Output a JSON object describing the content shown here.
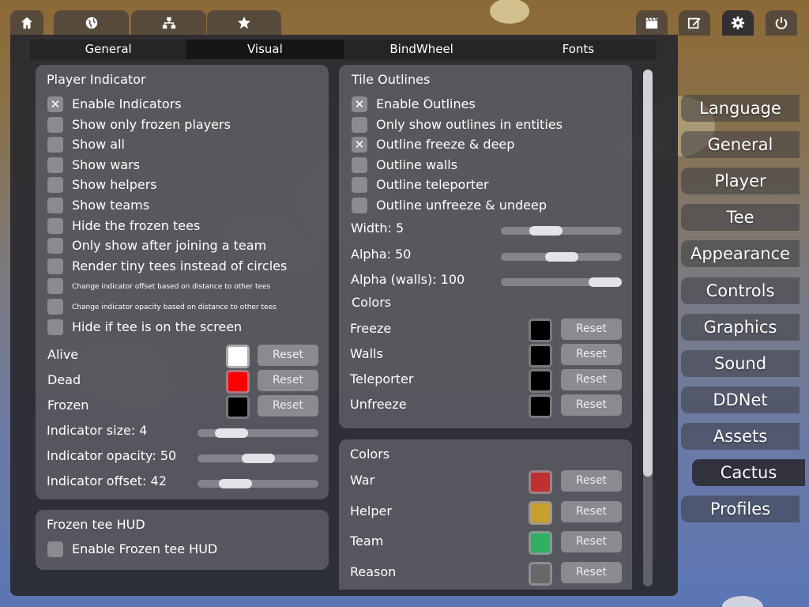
{
  "top_icons": {
    "home": "home-icon",
    "globe": "globe-icon",
    "network": "network-icon",
    "star": "star-icon",
    "demo": "clapperboard-icon",
    "editor": "edit-icon",
    "settings": "gear-icon",
    "quit": "power-icon"
  },
  "subtabs": [
    "General",
    "Visual",
    "BindWheel",
    "Fonts"
  ],
  "active_subtab": "Visual",
  "player_indicator": {
    "title": "Player Indicator",
    "options": [
      {
        "label": "Enable Indicators",
        "checked": true
      },
      {
        "label": "Show only frozen players",
        "checked": false
      },
      {
        "label": "Show all",
        "checked": false
      },
      {
        "label": "Show wars",
        "checked": false
      },
      {
        "label": "Show helpers",
        "checked": false
      },
      {
        "label": "Show teams",
        "checked": false
      },
      {
        "label": "Hide the frozen tees",
        "checked": false
      },
      {
        "label": "Only show after joining a team",
        "checked": false
      },
      {
        "label": "Render tiny tees instead of circles",
        "checked": false
      },
      {
        "label": "Change indicator offset based on distance to other tees",
        "checked": false
      },
      {
        "label": "Change indicator opacity based on distance to other tees",
        "checked": false
      },
      {
        "label": "Hide if tee is on the screen",
        "checked": false
      }
    ],
    "colors": [
      {
        "label": "Alive",
        "color": "#ffffff",
        "reset": "Reset"
      },
      {
        "label": "Dead",
        "color": "#ff0000",
        "reset": "Reset"
      },
      {
        "label": "Frozen",
        "color": "#000000",
        "reset": "Reset"
      }
    ],
    "sliders": [
      {
        "label": "Indicator size: 4",
        "value": 0.2
      },
      {
        "label": "Indicator opacity: 50",
        "value": 0.5
      },
      {
        "label": "Indicator offset: 42",
        "value": 0.24
      }
    ]
  },
  "frozen_hud": {
    "title": "Frozen tee HUD",
    "option": "Enable Frozen tee HUD",
    "checked": false
  },
  "tile_outlines": {
    "title": "Tile Outlines",
    "options": [
      {
        "label": "Enable Outlines",
        "checked": true
      },
      {
        "label": "Only show outlines in entities",
        "checked": false
      },
      {
        "label": "Outline freeze & deep",
        "checked": true
      },
      {
        "label": "Outline walls",
        "checked": false
      },
      {
        "label": "Outline teleporter",
        "checked": false
      },
      {
        "label": "Outline unfreeze & undeep",
        "checked": false
      }
    ],
    "sliders": [
      {
        "label": "Width: 5",
        "value": 0.32
      },
      {
        "label": "Alpha: 50",
        "value": 0.5
      },
      {
        "label": "Alpha (walls): 100",
        "value": 1.0
      }
    ],
    "colors_title": "Colors",
    "colors": [
      {
        "label": "Freeze",
        "color": "#000000",
        "reset": "Reset"
      },
      {
        "label": "Walls",
        "color": "#000000",
        "reset": "Reset"
      },
      {
        "label": "Teleporter",
        "color": "#000000",
        "reset": "Reset"
      },
      {
        "label": "Unfreeze",
        "color": "#000000",
        "reset": "Reset"
      }
    ]
  },
  "colors_panel": {
    "title": "Colors",
    "colors": [
      {
        "label": "War",
        "color": "#c03030",
        "reset": "Reset"
      },
      {
        "label": "Helper",
        "color": "#c8a030",
        "reset": "Reset"
      },
      {
        "label": "Team",
        "color": "#30b060",
        "reset": "Reset"
      },
      {
        "label": "Reason",
        "color": "#686868",
        "reset": "Reset"
      }
    ]
  },
  "settings_menu": [
    "Language",
    "General",
    "Player",
    "Tee",
    "Appearance",
    "Controls",
    "Graphics",
    "Sound",
    "DDNet",
    "Assets",
    "Cactus",
    "Profiles"
  ],
  "active_settings": "Cactus"
}
